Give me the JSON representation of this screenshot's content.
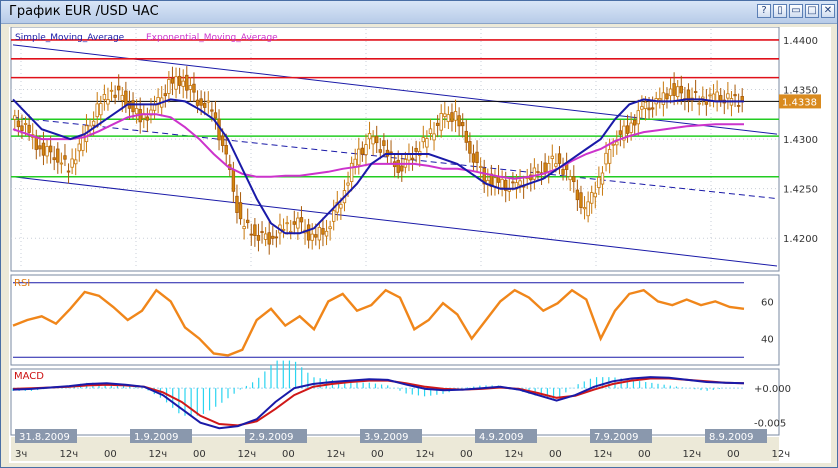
{
  "window": {
    "title": "График EUR /USD  ЧАС",
    "buttons": [
      {
        "name": "help-button",
        "glyph": "?"
      },
      {
        "name": "restore-button",
        "glyph": "▯"
      },
      {
        "name": "minimize-button",
        "glyph": "▭"
      },
      {
        "name": "maximize-button",
        "glyph": "□"
      },
      {
        "name": "close-button",
        "glyph": "✕"
      }
    ]
  },
  "chart_data": [
    {
      "type": "candlestick",
      "panel": "price",
      "legend": [
        {
          "name": "Simple_Moving_Average",
          "color": "#1a1aa8"
        },
        {
          "name": "Exponential_Moving_Average",
          "color": "#cc33cc"
        }
      ],
      "y_ticks": [
        "1.4400",
        "1.4350",
        "1.4300",
        "1.4250",
        "1.4200"
      ],
      "ylim": [
        1.4175,
        1.4405
      ],
      "last_price": "1.4338",
      "last_price_value": 1.4338,
      "horizontal_levels": [
        {
          "value": 1.44,
          "color": "#e0101a"
        },
        {
          "value": 1.4381,
          "color": "#e0101a"
        },
        {
          "value": 1.4362,
          "color": "#e0101a"
        },
        {
          "value": 1.432,
          "color": "#22cc22"
        },
        {
          "value": 1.4303,
          "color": "#22cc22"
        },
        {
          "value": 1.4262,
          "color": "#22cc22"
        },
        {
          "value": 1.4338,
          "color": "#000000"
        }
      ],
      "close_series": [
        1.432,
        1.431,
        1.429,
        1.4285,
        1.427,
        1.43,
        1.433,
        1.435,
        1.434,
        1.432,
        1.433,
        1.4355,
        1.436,
        1.434,
        1.433,
        1.428,
        1.4215,
        1.4205,
        1.42,
        1.421,
        1.4215,
        1.42,
        1.421,
        1.424,
        1.428,
        1.43,
        1.429,
        1.427,
        1.4285,
        1.43,
        1.432,
        1.4325,
        1.429,
        1.426,
        1.4255,
        1.425,
        1.426,
        1.427,
        1.428,
        1.426,
        1.4225,
        1.426,
        1.43,
        1.431,
        1.433,
        1.4335,
        1.435,
        1.4345,
        1.434,
        1.4342,
        1.434,
        1.4338
      ],
      "sma_series": [
        1.434,
        1.4325,
        1.431,
        1.4305,
        1.43,
        1.4305,
        1.4315,
        1.4325,
        1.4335,
        1.4335,
        1.4335,
        1.434,
        1.4338,
        1.433,
        1.432,
        1.43,
        1.427,
        1.424,
        1.4215,
        1.4205,
        1.4205,
        1.421,
        1.4225,
        1.424,
        1.4255,
        1.4275,
        1.4285,
        1.4285,
        1.4285,
        1.4285,
        1.428,
        1.4275,
        1.4265,
        1.4255,
        1.425,
        1.425,
        1.4255,
        1.426,
        1.427,
        1.428,
        1.429,
        1.43,
        1.432,
        1.4335,
        1.434,
        1.4338,
        1.4338,
        1.434,
        1.434,
        1.4338,
        1.4338,
        1.4338
      ],
      "ema_series": [
        1.431,
        1.4305,
        1.43,
        1.43,
        1.43,
        1.4302,
        1.4308,
        1.4315,
        1.4322,
        1.4325,
        1.4325,
        1.4322,
        1.4312,
        1.43,
        1.4285,
        1.4272,
        1.4265,
        1.4262,
        1.4262,
        1.4263,
        1.4263,
        1.4265,
        1.4267,
        1.427,
        1.4272,
        1.4275,
        1.4275,
        1.4275,
        1.4275,
        1.4273,
        1.427,
        1.427,
        1.4268,
        1.4265,
        1.4262,
        1.426,
        1.4262,
        1.4265,
        1.427,
        1.4278,
        1.4285,
        1.429,
        1.4298,
        1.4303,
        1.4307,
        1.4309,
        1.4311,
        1.4313,
        1.4314,
        1.4315,
        1.4315,
        1.4315
      ]
    },
    {
      "type": "line",
      "panel": "rsi",
      "title": "RSI",
      "y_ticks": [
        "60",
        "40"
      ],
      "ylim": [
        28,
        72
      ],
      "levels": [
        70,
        30
      ],
      "values": [
        47,
        50,
        52,
        48,
        56,
        65,
        63,
        57,
        50,
        55,
        66,
        60,
        46,
        40,
        32,
        31,
        34,
        50,
        56,
        47,
        52,
        45,
        60,
        64,
        55,
        58,
        66,
        62,
        45,
        50,
        59,
        53,
        40,
        50,
        60,
        66,
        62,
        55,
        59,
        66,
        61,
        40,
        55,
        64,
        66,
        60,
        58,
        61,
        58,
        60,
        57,
        56
      ]
    },
    {
      "type": "histogram_line",
      "panel": "macd",
      "title": "MACD",
      "y_ticks": [
        "+0.000",
        "-0.005"
      ],
      "ylim": [
        -0.0065,
        0.0022
      ],
      "macd": [
        -0.0002,
        -0.0001,
        0.0001,
        0.0003,
        0.0006,
        0.0007,
        0.0005,
        0.0002,
        -0.001,
        -0.003,
        -0.005,
        -0.0058,
        -0.0055,
        -0.0045,
        -0.002,
        0.0,
        0.0006,
        0.0009,
        0.0011,
        0.0013,
        0.0012,
        0.0005,
        -0.0001,
        -0.0003,
        -0.0002,
        0.0,
        0.0002,
        -0.0002,
        -0.001,
        -0.0018,
        -0.001,
        0.0002,
        0.001,
        0.0014,
        0.0016,
        0.0015,
        0.0012,
        0.0009,
        0.0008,
        0.0007
      ],
      "signal": [
        -0.0001,
        0.0,
        0.0001,
        0.0002,
        0.0004,
        0.0005,
        0.0004,
        0.0002,
        -0.0006,
        -0.002,
        -0.004,
        -0.0052,
        -0.0054,
        -0.0048,
        -0.003,
        -0.001,
        0.0002,
        0.0006,
        0.0009,
        0.0011,
        0.0011,
        0.0007,
        0.0002,
        -0.0001,
        -0.0002,
        -0.0001,
        0.0001,
        -0.0001,
        -0.0007,
        -0.0014,
        -0.0011,
        -0.0002,
        0.0006,
        0.0011,
        0.0014,
        0.0014,
        0.0012,
        0.001,
        0.0008,
        0.0007
      ]
    }
  ],
  "date_labels": [
    "31.8.2009",
    "1.9.2009",
    "2.9.2009",
    "3.9.2009",
    "4.9.2009",
    "7.9.2009",
    "8.9.2009"
  ],
  "hour_labels": [
    "3ч",
    "12ч",
    "00",
    "12ч",
    "00",
    "12ч",
    "00",
    "12ч",
    "00",
    "12ч",
    "00",
    "12ч",
    "00",
    "12ч",
    "00",
    "12ч",
    "00",
    "12ч"
  ]
}
